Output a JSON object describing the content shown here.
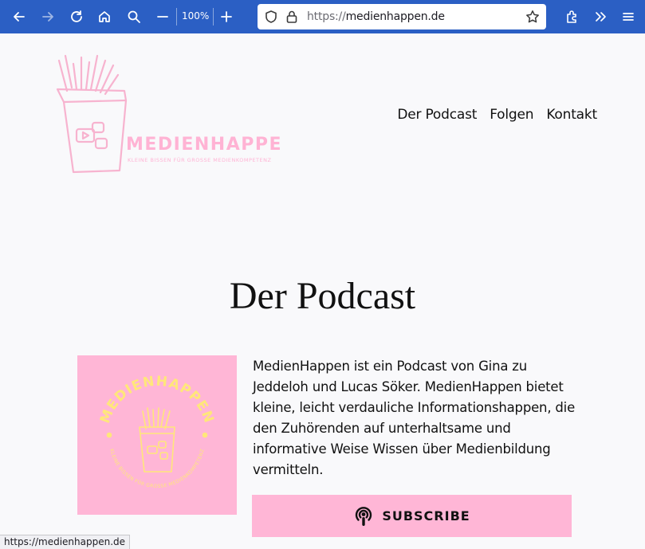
{
  "browser": {
    "zoom_level": "100%",
    "url_scheme": "https://",
    "url_host": "medienhappen.de"
  },
  "site": {
    "logo_title": "MEDIENHAPPEN",
    "logo_tagline": "KLEINE BISSEN FÜR GROSSE MEDIENKOMPETENZ",
    "nav": [
      "Der Podcast",
      "Folgen",
      "Kontakt"
    ]
  },
  "main": {
    "title": "Der Podcast",
    "cover_title": "MEDIENHAPPEN",
    "cover_tagline": "KLEINE BISSEN FÜR GROSSE MEDIENKOMPETENZ",
    "description": "MedienHappen ist ein Podcast von Gina zu Jeddeloh und Lucas Söker. MedienHappen bietet kleine, leicht verdauliche Informationshappen, die den Zuhörenden auf unterhaltsame und informative Weise Wissen über Medienbildung vermitteln.",
    "subscribe_label": "SUBSCRIBE"
  },
  "status_bar": {
    "link": "https://medienhappen.de"
  },
  "colors": {
    "toolbar": "#2b5fc4",
    "brand_pink": "#ffb6d6",
    "brand_yellow": "#ffe77a",
    "page_bg": "#f9f9fb"
  }
}
